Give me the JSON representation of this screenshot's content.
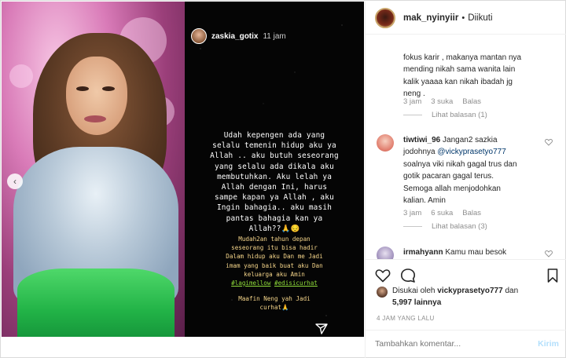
{
  "header": {
    "username": "mak_nyinyiir",
    "separator": "•",
    "follow_status": "Diikuti"
  },
  "story": {
    "username": "zaskia_gotix",
    "time": "11 jam",
    "main_lines": [
      "Udah kepengen ada yang",
      "selalu temenin hidup aku ya",
      "Allah .. aku butuh seseorang",
      "yang selalu ada dikala aku",
      "membutuhkan. Aku lelah ya",
      "Allah dengan Ini, harus",
      "sampe kapan ya Allah , aku",
      "Ingin bahagia.. aku masih",
      "pantas bahagia kan ya",
      "Allah??🙏😔"
    ],
    "sub_lines": [
      "Mudah2an tahun depan",
      "seseorang itu bisa hadir",
      "Dalam hidup aku Dan me Jadi",
      "imam yang baik buat aku Dan",
      "keluarga aku Amin"
    ],
    "tags": [
      "#lagimellow",
      "#edisicurhat"
    ],
    "foot_lines": [
      "Maafin Neng yah Jadi",
      "curhat🙏"
    ]
  },
  "comments": [
    {
      "text_lines": [
        "fokus karir , makanya mantan nya",
        "mending nikah sama wanita lain",
        "kalik yaaaa kan nikah ibadah jg",
        "neng ."
      ],
      "time": "3 jam",
      "likes": "3 suka",
      "reply": "Balas",
      "view_replies": "Lihat balasan (1)"
    },
    {
      "username": "tiwtiwi_96",
      "text_first": "Jangan2 sazkia",
      "text_line2_pre": "jodohnya ",
      "mention": "@vickyprasetyo777",
      "text_lines": [
        "soalnya viki nikah gagal trus dan",
        "gotik pacaran gagal terus.",
        "Semoga allah menjodohkan",
        "kalian. Amin"
      ],
      "time": "3 jam",
      "likes": "6 suka",
      "reply": "Balas",
      "view_replies": "Lihat balasan (3)"
    },
    {
      "username": "irmahyann",
      "text": "Kamu mau besok"
    }
  ],
  "likes": {
    "prefix": "Disukai oleh",
    "user": "vickyprasetyo777",
    "and": "dan",
    "others": "5,997 lainnya"
  },
  "time_ago": "4 JAM YANG LALU",
  "comment_box": {
    "placeholder": "Tambahkan komentar...",
    "post_label": "Kirim"
  }
}
